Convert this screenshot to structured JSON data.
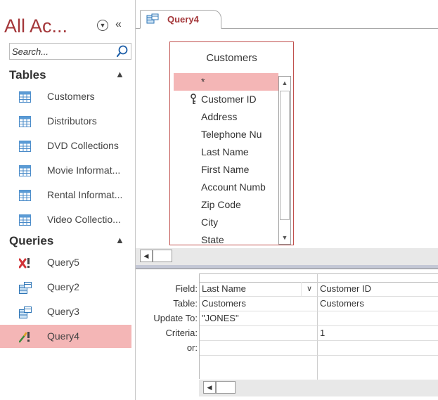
{
  "navigation": {
    "title": "All Ac...",
    "search": {
      "placeholder": "Search...",
      "value": ""
    },
    "groups": [
      {
        "label": "Tables",
        "items": [
          {
            "label": "Customers",
            "icon": "table-icon"
          },
          {
            "label": "Distributors",
            "icon": "table-icon"
          },
          {
            "label": "DVD Collections",
            "icon": "table-icon"
          },
          {
            "label": "Movie Informat...",
            "icon": "table-icon"
          },
          {
            "label": "Rental Informat...",
            "icon": "table-icon"
          },
          {
            "label": "Video Collectio...",
            "icon": "table-icon"
          }
        ]
      },
      {
        "label": "Queries",
        "items": [
          {
            "label": "Query5",
            "icon": "delete-query-icon"
          },
          {
            "label": "Query2",
            "icon": "select-query-icon"
          },
          {
            "label": "Query3",
            "icon": "select-query-icon"
          },
          {
            "label": "Query4",
            "icon": "update-query-icon",
            "selected": true
          }
        ]
      }
    ]
  },
  "document": {
    "tab_label": "Query4",
    "table": {
      "title": "Customers",
      "fields": [
        "*",
        "Customer ID",
        "Address",
        "Telephone Nu",
        "Last Name",
        "First Name",
        "Account Numb",
        "Zip Code",
        "City",
        "State"
      ],
      "primary_key": "Customer ID"
    },
    "grid": {
      "row_labels": [
        "Field:",
        "Table:",
        "Update To:",
        "Criteria:",
        "or:"
      ],
      "columns": [
        {
          "field": "Last Name",
          "table": "Customers",
          "update_to": "\"JONES\"",
          "criteria": "",
          "or": ""
        },
        {
          "field": "Customer ID",
          "table": "Customers",
          "update_to": "",
          "criteria": "1",
          "or": ""
        }
      ]
    }
  },
  "colors": {
    "accent": "#a4373a",
    "selection": "#f4b6b6",
    "table_border": "#c0504d",
    "table_icon": "#5b9bd5"
  }
}
